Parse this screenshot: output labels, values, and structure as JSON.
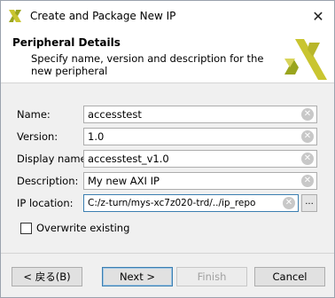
{
  "window": {
    "title": "Create and Package New IP",
    "close_glyph": "✕"
  },
  "header": {
    "title": "Peripheral Details",
    "description": "Specify name, version and description for the new peripheral"
  },
  "form": {
    "name": {
      "label": "Name:",
      "value": "accesstest"
    },
    "version": {
      "label": "Version:",
      "value": "1.0"
    },
    "display_name": {
      "label": "Display name:",
      "value": "accesstest_v1.0"
    },
    "description": {
      "label": "Description:",
      "value": "My new AXI IP"
    },
    "ip_location": {
      "label": "IP location:",
      "value": "C:/z-turn/mys-xc7z020-trd/../ip_repo",
      "browse_label": "..."
    },
    "overwrite": {
      "label": "Overwrite existing",
      "checked": false
    }
  },
  "buttons": {
    "back": "< 戻る(B)",
    "next": "Next >",
    "finish": "Finish",
    "cancel": "Cancel"
  },
  "icons": {
    "app": "vivado-logo-icon",
    "clear": "clear-icon",
    "close": "close-icon"
  },
  "colors": {
    "logo_yellow": "#c9c530",
    "focus_border": "#3c7fb1"
  }
}
